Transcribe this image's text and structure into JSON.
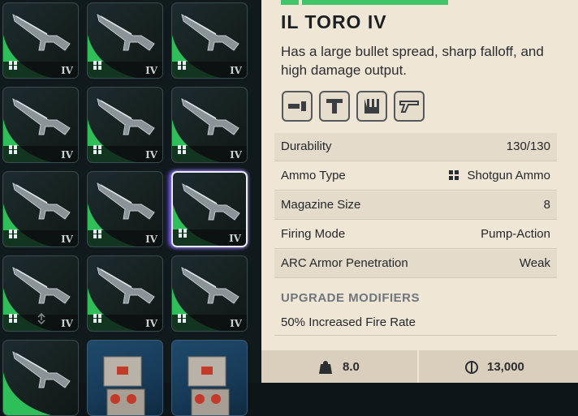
{
  "inventory": {
    "slots": [
      {
        "tier": "IV",
        "kind": "shotgun",
        "ammo": true
      },
      {
        "tier": "IV",
        "kind": "shotgun",
        "ammo": true
      },
      {
        "tier": "IV",
        "kind": "shotgun",
        "ammo": true
      },
      {
        "tier": "IV",
        "kind": "shotgun",
        "ammo": true
      },
      {
        "tier": "IV",
        "kind": "shotgun",
        "ammo": true
      },
      {
        "tier": "IV",
        "kind": "shotgun",
        "ammo": true
      },
      {
        "tier": "IV",
        "kind": "shotgun",
        "ammo": true
      },
      {
        "tier": "IV",
        "kind": "shotgun",
        "ammo": true
      },
      {
        "tier": "IV",
        "kind": "shotgun",
        "ammo": true,
        "selected": true
      },
      {
        "tier": "IV",
        "kind": "shotgun",
        "ammo": true,
        "extra_icon": "recycle-icon"
      },
      {
        "tier": "IV",
        "kind": "shotgun",
        "ammo": true
      },
      {
        "tier": "IV",
        "kind": "shotgun",
        "ammo": true
      },
      {
        "tier": "",
        "kind": "shotgun",
        "ammo": false
      },
      {
        "tier": "",
        "kind": "crate",
        "ammo": false
      },
      {
        "tier": "",
        "kind": "crate",
        "ammo": false
      }
    ]
  },
  "item": {
    "name": "IL TORO IV",
    "description": "Has a large bullet spread, sharp falloff, and high damage output.",
    "rarity_color": "#3fc46a",
    "tag_icons": [
      "magazine-icon",
      "t-bar-icon",
      "grip-icon",
      "stock-icon"
    ],
    "stats": [
      {
        "label": "Durability",
        "value": "130/130"
      },
      {
        "label": "Ammo Type",
        "value": "Shotgun Ammo",
        "icon": "shotgun-ammo-icon"
      },
      {
        "label": "Magazine Size",
        "value": "8"
      },
      {
        "label": "Firing Mode",
        "value": "Pump-Action"
      },
      {
        "label": "ARC Armor Penetration",
        "value": "Weak"
      }
    ],
    "modifiers_header": "UPGRADE MODIFIERS",
    "modifiers": [
      "50% Increased Fire Rate"
    ],
    "weight": "8.0",
    "price": "13,000"
  },
  "colors": {
    "panel_bg": "#efe6d6",
    "slot_green": "#2fbf5a",
    "selection_glow": "#7a5bff"
  }
}
